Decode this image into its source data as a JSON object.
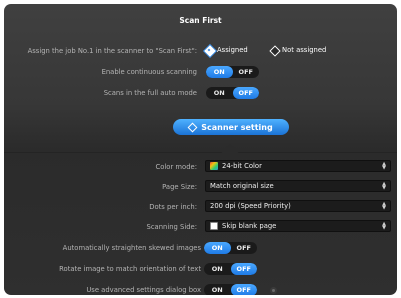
{
  "title": "Scan First",
  "top": {
    "assign_label": "Assign the job No.1 in the scanner to \"Scan First\":",
    "assigned": "Assigned",
    "not_assigned": "Not assigned",
    "continuous_label": "Enable continuous scanning",
    "full_auto_label": "Scans in the full auto mode"
  },
  "toggle": {
    "on": "ON",
    "off": "OFF"
  },
  "scanner_button": "Scanner setting",
  "settings": {
    "color_mode_label": "Color mode:",
    "color_mode_value": "24-bit Color",
    "page_size_label": "Page Size:",
    "page_size_value": "Match original size",
    "dpi_label": "Dots per inch:",
    "dpi_value": "200 dpi (Speed Priority)",
    "side_label": "Scanning Side:",
    "side_value": "Skip blank page",
    "straighten_label": "Automatically straighten skewed images",
    "rotate_label": "Rotate image to match orientation of text",
    "advanced_label": "Use advanced settings dialog box"
  },
  "colors": {
    "accent": "#2b8af0",
    "panel": "#383838"
  },
  "icons": {
    "color_mode": "color-palette-icon",
    "side": "page-icon",
    "advanced": "gear-icon"
  }
}
